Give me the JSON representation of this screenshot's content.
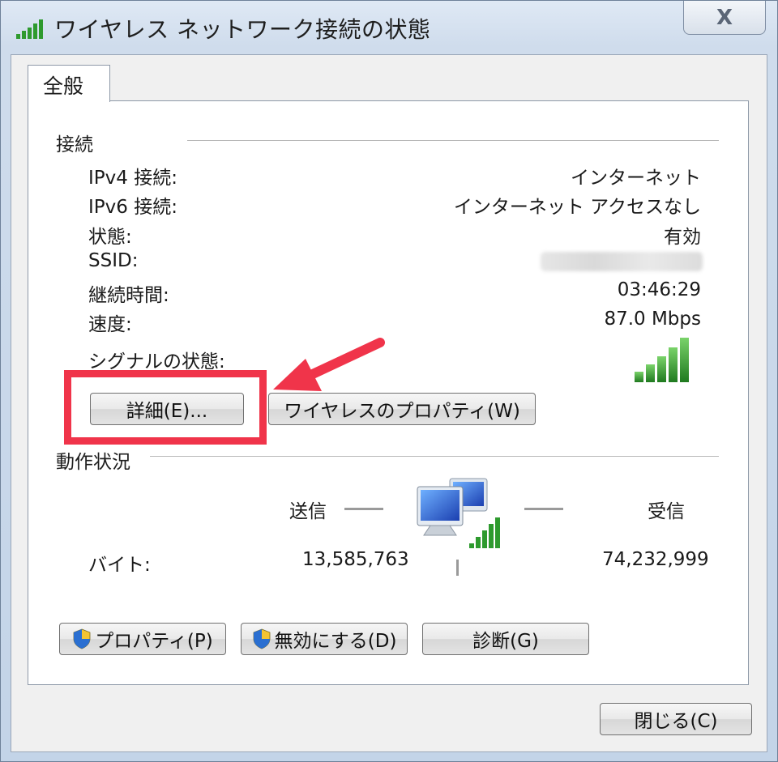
{
  "window": {
    "title": "ワイヤレス ネットワーク接続の状態",
    "close_label": "X"
  },
  "tabs": [
    {
      "label": "全般"
    }
  ],
  "connection": {
    "header": "接続",
    "rows": [
      {
        "label": "IPv4 接続:",
        "value": "インターネット"
      },
      {
        "label": "IPv6 接続:",
        "value": "インターネット アクセスなし"
      },
      {
        "label": "状態:",
        "value": "有効"
      },
      {
        "label": "SSID:",
        "value": ""
      },
      {
        "label": "継続時間:",
        "value": "03:46:29"
      },
      {
        "label": "速度:",
        "value": "87.0 Mbps"
      }
    ],
    "signal_label": "シグナルの状態:",
    "details_button": "詳細(E)...",
    "wireless_props_button": "ワイヤレスのプロパティ(W)"
  },
  "activity": {
    "header": "動作状況",
    "sent_label": "送信",
    "received_label": "受信",
    "bytes_label": "バイト:",
    "bytes_sent": "13,585,763",
    "bytes_received": "74,232,999"
  },
  "bottom_buttons": {
    "properties": "プロパティ(P)",
    "disable": "無効にする(D)",
    "diagnose": "診断(G)"
  },
  "footer": {
    "close_button": "閉じる(C)"
  },
  "colors": {
    "highlight": "#f0344a",
    "signal": "#2e9a2e",
    "accent_blue": "#2a6fd1"
  },
  "icons": {
    "title_icon": "wifi-signal-icon",
    "signal_icon": "wifi-signal-icon",
    "network_icon": "network-computers-icon",
    "shield_icon": "uac-shield-icon"
  }
}
